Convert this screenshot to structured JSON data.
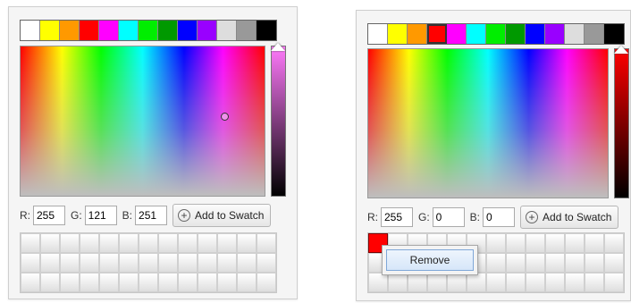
{
  "left_picker": {
    "presets": [
      "#ffffff",
      "#ffff00",
      "#ff9900",
      "#ff0000",
      "#ff00ff",
      "#00ffff",
      "#00ee00",
      "#009900",
      "#0000ff",
      "#9900ff",
      "#dddddd",
      "#999999",
      "#000000"
    ],
    "r_label": "R:",
    "g_label": "G:",
    "b_label": "B:",
    "r_value": "255",
    "g_value": "121",
    "b_value": "251",
    "add_label": "Add to Swatch",
    "swatches": []
  },
  "right_picker": {
    "presets": [
      "#ffffff",
      "#ffff00",
      "#ff9900",
      "#ff0000",
      "#ff00ff",
      "#00ffff",
      "#00ee00",
      "#009900",
      "#0000ff",
      "#9900ff",
      "#dddddd",
      "#999999",
      "#000000"
    ],
    "selected_preset": 3,
    "r_label": "R:",
    "g_label": "G:",
    "b_label": "B:",
    "r_value": "255",
    "g_value": "0",
    "b_value": "0",
    "add_label": "Add to Swatch",
    "swatches": [
      "#ff0000"
    ],
    "context_menu": {
      "remove_label": "Remove"
    }
  },
  "icons": {
    "add": "plus-circle-icon"
  }
}
